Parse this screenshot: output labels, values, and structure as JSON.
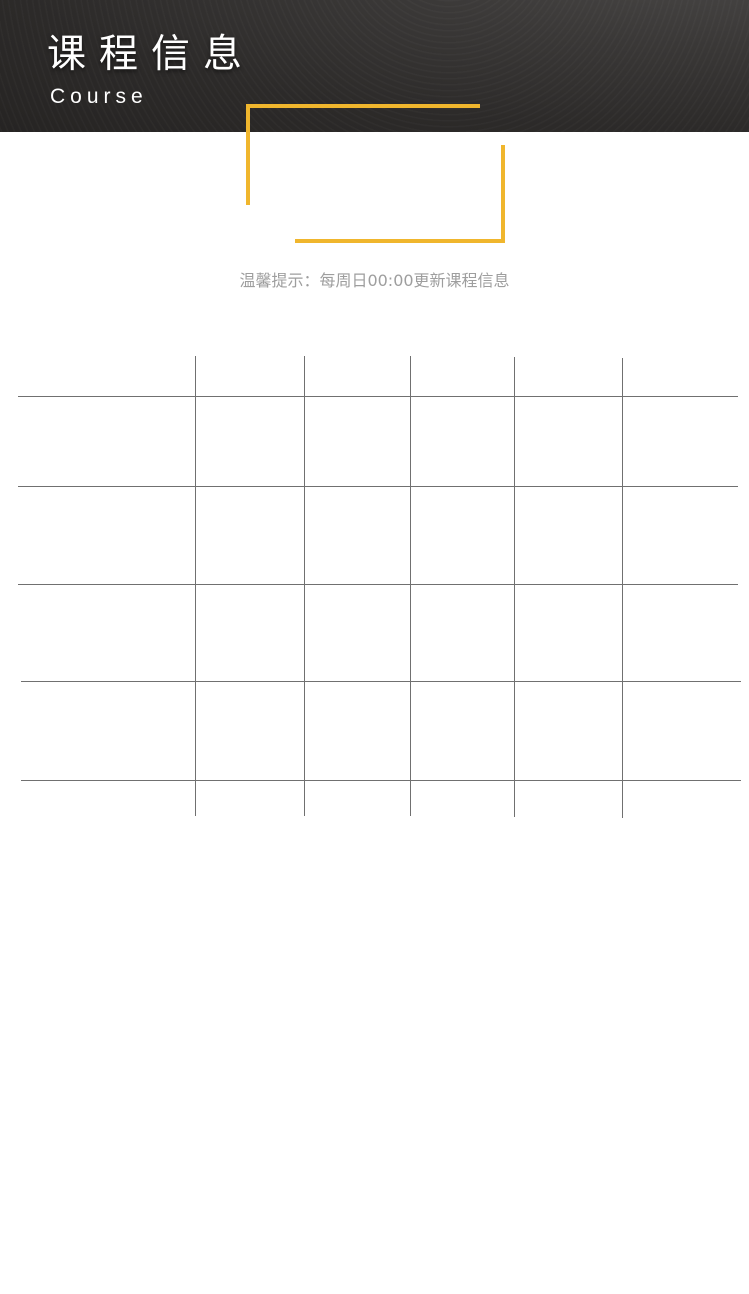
{
  "header": {
    "title": "课程信息",
    "subtitle": "Course"
  },
  "notice": {
    "text": "温馨提示：每周日00:00更新课程信息"
  },
  "colors": {
    "header_bg": "#2c2a29",
    "accent": "#f0b62d",
    "hint_text": "#9e9e9e",
    "grid_line": "#707070"
  },
  "schedule_table": {
    "columns": 6,
    "rows": 4,
    "cells": [
      [
        "",
        "",
        "",
        "",
        "",
        ""
      ],
      [
        "",
        "",
        "",
        "",
        "",
        ""
      ],
      [
        "",
        "",
        "",
        "",
        "",
        ""
      ],
      [
        "",
        "",
        "",
        "",
        "",
        ""
      ]
    ]
  }
}
